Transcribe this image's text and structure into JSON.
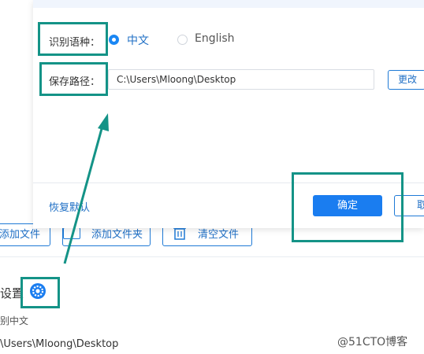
{
  "background": {
    "buttons": {
      "add_file": "添加文件",
      "add_folder": "添加文件夹",
      "clear_files": "清空文件"
    },
    "settings_label": "设置",
    "lang_text": "别中文",
    "path_text": "\\Users\\Mloong\\Desktop"
  },
  "dialog": {
    "lang_label": "识别语种：",
    "lang_options": [
      {
        "label": "中文",
        "selected": true
      },
      {
        "label": "English",
        "selected": false
      }
    ],
    "path_label": "保存路径：",
    "path_value": "C:\\Users\\Mloong\\Desktop",
    "change_button": "更改",
    "restore_link": "恢复默认",
    "ok_button": "确定",
    "cancel_button": "取"
  },
  "watermark": "@51CTO博客",
  "colors": {
    "accent": "#1a7df0",
    "annotation": "#149387"
  },
  "icons": [
    "folder-icon",
    "trash-icon",
    "gear-icon",
    "annotation-arrow-icon"
  ]
}
